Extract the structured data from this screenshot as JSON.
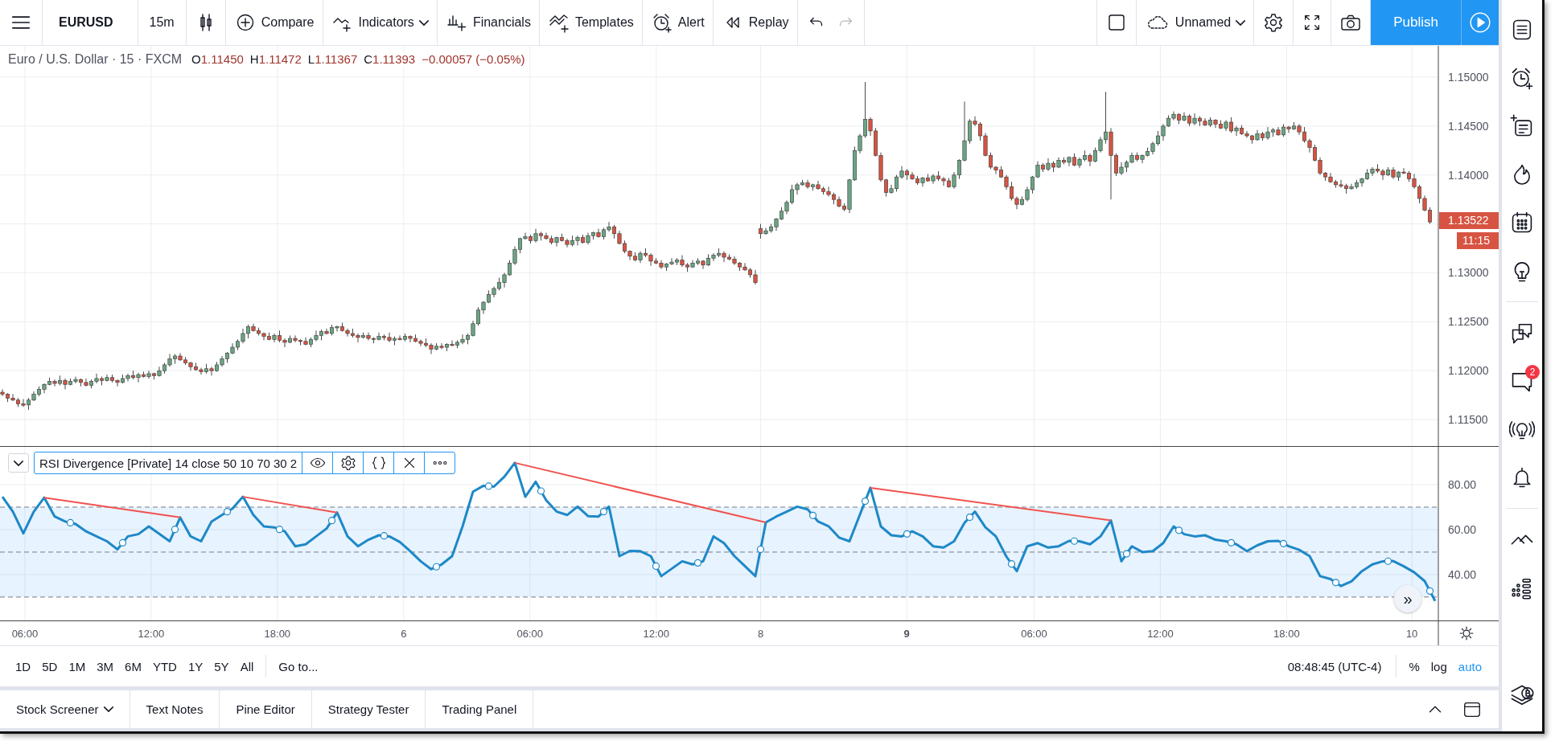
{
  "toolbar": {
    "symbol": "EURUSD",
    "interval": "15m",
    "buttons": [
      {
        "label": "Compare",
        "dropdown": false
      },
      {
        "label": "Indicators",
        "dropdown": true
      },
      {
        "label": "Financials",
        "dropdown": false
      },
      {
        "label": "Templates",
        "dropdown": false
      },
      {
        "label": "Alert",
        "dropdown": false
      },
      {
        "label": "Replay",
        "dropdown": false
      }
    ],
    "undo": {
      "disabled": false
    },
    "redo": {
      "disabled": true
    },
    "layout": {
      "label": "Unnamed",
      "dropdown": true
    },
    "publish": "Publish"
  },
  "legend": {
    "title": "Euro / U.S. Dollar · 15 · FXCM",
    "ohlc": [
      {
        "label": "O",
        "value": "1.11450"
      },
      {
        "label": "H",
        "value": "1.11472"
      },
      {
        "label": "L",
        "value": "1.11367"
      },
      {
        "label": "C",
        "value": "1.11393"
      }
    ],
    "change": "−0.00057 (−0.05%)"
  },
  "price_pane": {
    "last_price": "1.13522",
    "countdown": "11:15",
    "chart_data": {
      "type": "candlestick",
      "ylim": [
        1.1123,
        1.1532
      ],
      "grid": true,
      "yticks": [
        {
          "value": 1.15,
          "label": "1.15000"
        },
        {
          "value": 1.145,
          "label": "1.14500"
        },
        {
          "value": 1.14,
          "label": "1.14000"
        },
        {
          "value": 1.13,
          "label": "1.13000"
        },
        {
          "value": 1.125,
          "label": "1.12500"
        },
        {
          "value": 1.12,
          "label": "1.12000"
        },
        {
          "value": 1.115,
          "label": "1.11500"
        }
      ],
      "categories": [
        null,
        null,
        null,
        null,
        null,
        null,
        null,
        null,
        null,
        null,
        null,
        null,
        null,
        null,
        null,
        null,
        null,
        null,
        null,
        null,
        null,
        null,
        null,
        null,
        null,
        null,
        null,
        null,
        null,
        null,
        null,
        null,
        null,
        null,
        null,
        null,
        null,
        null,
        null,
        null,
        null,
        null,
        null,
        null,
        null,
        null,
        null,
        null,
        null,
        null,
        null,
        null,
        null,
        null,
        null,
        null,
        null,
        null,
        null,
        null,
        null,
        null,
        null,
        null,
        null,
        null,
        null,
        null,
        null,
        null,
        null,
        null,
        null,
        null,
        null,
        null,
        null,
        null,
        null,
        null,
        null,
        null,
        null,
        null,
        null,
        null,
        null,
        null,
        null,
        null,
        null,
        null,
        null,
        null,
        null,
        null,
        null,
        null,
        null,
        null,
        null,
        null,
        null,
        null,
        null,
        null,
        null,
        null,
        null,
        null,
        null,
        null,
        null,
        null,
        null,
        null,
        null,
        null,
        null,
        null,
        null,
        null,
        null,
        null,
        null,
        null,
        null,
        null,
        null,
        null,
        null,
        null,
        null,
        null,
        null,
        null,
        null,
        null,
        null,
        null,
        null,
        null,
        null,
        null,
        null,
        null,
        null,
        null,
        null,
        null,
        null,
        null,
        null,
        null,
        null,
        null,
        null,
        null,
        null,
        null,
        null,
        null,
        null,
        null,
        null,
        null,
        null,
        null,
        null,
        null,
        null,
        null,
        null,
        null,
        null,
        null,
        null,
        null,
        null,
        null,
        null,
        null,
        null,
        null,
        null,
        null,
        null,
        null,
        null,
        null,
        null,
        null,
        null,
        null,
        null,
        null,
        null,
        null,
        null,
        null,
        null,
        null,
        null,
        null,
        null,
        null,
        null,
        null,
        null,
        null,
        null,
        null,
        null,
        null,
        null,
        null,
        null,
        null,
        null,
        null,
        null,
        null,
        null,
        null,
        null,
        null,
        null,
        null,
        null,
        null,
        null,
        null,
        null,
        null,
        null,
        null,
        null,
        null,
        null,
        null,
        null,
        null,
        null,
        null,
        null,
        null,
        null,
        null,
        null,
        null,
        null,
        null,
        null,
        null,
        null,
        null,
        null,
        null,
        null,
        null,
        null,
        null,
        null,
        null,
        null,
        null,
        null,
        null,
        null,
        null,
        null,
        null,
        null,
        null
      ],
      "ohlc": [
        [
          1.1178,
          1.1181,
          1.1174,
          1.1176
        ],
        [
          1.1176,
          1.1177,
          1.1168,
          1.1172
        ],
        [
          1.1172,
          1.1176,
          1.1169,
          1.117
        ],
        [
          1.117,
          1.1172,
          1.1163,
          1.1166
        ],
        [
          1.1166,
          1.1171,
          1.1163,
          1.1165
        ],
        [
          1.1165,
          1.1172,
          1.116,
          1.117
        ],
        [
          1.117,
          1.1179,
          1.1169,
          1.1176
        ],
        [
          1.1176,
          1.1184,
          1.1174,
          1.1181
        ],
        [
          1.1181,
          1.1187,
          1.1177,
          1.1186
        ],
        [
          1.1186,
          1.1193,
          1.1185,
          1.1189
        ],
        [
          1.1189,
          1.1191,
          1.1184,
          1.1187
        ],
        [
          1.1187,
          1.1195,
          1.1185,
          1.119
        ],
        [
          1.119,
          1.1192,
          1.1181,
          1.1186
        ],
        [
          1.1186,
          1.1192,
          1.1185,
          1.1189
        ],
        [
          1.1189,
          1.1194,
          1.1187,
          1.1191
        ],
        [
          1.1191,
          1.1192,
          1.1184,
          1.1188
        ],
        [
          1.1188,
          1.1192,
          1.1184,
          1.1185
        ],
        [
          1.1185,
          1.1191,
          1.1182,
          1.1189
        ],
        [
          1.1189,
          1.1197,
          1.1187,
          1.1192
        ],
        [
          1.1192,
          1.1194,
          1.1185,
          1.119
        ],
        [
          1.119,
          1.1196,
          1.1189,
          1.1193
        ],
        [
          1.1193,
          1.1196,
          1.1188,
          1.119
        ],
        [
          1.119,
          1.1191,
          1.1184,
          1.1188
        ],
        [
          1.1188,
          1.1196,
          1.1187,
          1.1192
        ],
        [
          1.1192,
          1.1197,
          1.1189,
          1.1195
        ],
        [
          1.1195,
          1.12,
          1.1191,
          1.1193
        ],
        [
          1.1193,
          1.1198,
          1.1188,
          1.1196
        ],
        [
          1.1196,
          1.1199,
          1.1193,
          1.1194
        ],
        [
          1.1194,
          1.12,
          1.1192,
          1.1197
        ],
        [
          1.1197,
          1.1198,
          1.1191,
          1.1195
        ],
        [
          1.1195,
          1.1204,
          1.1194,
          1.12
        ],
        [
          1.12,
          1.1208,
          1.1197,
          1.1206
        ],
        [
          1.1206,
          1.1217,
          1.1204,
          1.1212
        ],
        [
          1.1212,
          1.1217,
          1.1207,
          1.1215
        ],
        [
          1.1215,
          1.1218,
          1.121,
          1.1211
        ],
        [
          1.1211,
          1.1214,
          1.1206,
          1.1208
        ],
        [
          1.1208,
          1.1209,
          1.12,
          1.1204
        ],
        [
          1.1204,
          1.1208,
          1.12,
          1.1201
        ],
        [
          1.1201,
          1.1203,
          1.1196,
          1.1199
        ],
        [
          1.1199,
          1.1207,
          1.1197,
          1.1202
        ],
        [
          1.1202,
          1.1204,
          1.1195,
          1.12
        ],
        [
          1.12,
          1.1209,
          1.1199,
          1.1206
        ],
        [
          1.1206,
          1.1215,
          1.1204,
          1.1212
        ],
        [
          1.1212,
          1.1219,
          1.1208,
          1.1218
        ],
        [
          1.1218,
          1.1228,
          1.1217,
          1.1224
        ],
        [
          1.1224,
          1.1232,
          1.1221,
          1.123
        ],
        [
          1.123,
          1.1243,
          1.1228,
          1.1238
        ],
        [
          1.1238,
          1.1247,
          1.1233,
          1.1245
        ],
        [
          1.1245,
          1.1248,
          1.124,
          1.1241
        ],
        [
          1.1241,
          1.1244,
          1.1236,
          1.1238
        ],
        [
          1.1238,
          1.1239,
          1.1231,
          1.1235
        ],
        [
          1.1235,
          1.1239,
          1.1231,
          1.1232
        ],
        [
          1.1232,
          1.1238,
          1.1229,
          1.1236
        ],
        [
          1.1236,
          1.1241,
          1.1229,
          1.1231
        ],
        [
          1.1231,
          1.1233,
          1.1224,
          1.1229
        ],
        [
          1.1229,
          1.1236,
          1.1228,
          1.1233
        ],
        [
          1.1233,
          1.1236,
          1.1229,
          1.1231
        ],
        [
          1.1231,
          1.1232,
          1.1226,
          1.123
        ],
        [
          1.123,
          1.1234,
          1.1226,
          1.1227
        ],
        [
          1.1227,
          1.1234,
          1.1224,
          1.1232
        ],
        [
          1.1232,
          1.1241,
          1.123,
          1.1236
        ],
        [
          1.1236,
          1.1242,
          1.1231,
          1.124
        ],
        [
          1.124,
          1.1243,
          1.1237,
          1.1238
        ],
        [
          1.1238,
          1.1247,
          1.1236,
          1.1244
        ],
        [
          1.1244,
          1.1246,
          1.124,
          1.1245
        ],
        [
          1.1245,
          1.1249,
          1.124,
          1.1241
        ],
        [
          1.1241,
          1.1243,
          1.1235,
          1.1238
        ],
        [
          1.1238,
          1.1243,
          1.1234,
          1.1236
        ],
        [
          1.1236,
          1.1238,
          1.1229,
          1.1234
        ],
        [
          1.1234,
          1.1239,
          1.1233,
          1.1236
        ],
        [
          1.1236,
          1.1239,
          1.1231,
          1.1233
        ],
        [
          1.1233,
          1.1234,
          1.1228,
          1.1232
        ],
        [
          1.1232,
          1.1239,
          1.1231,
          1.1235
        ],
        [
          1.1235,
          1.1237,
          1.1231,
          1.1234
        ],
        [
          1.1234,
          1.1239,
          1.1229,
          1.1231
        ],
        [
          1.1231,
          1.1235,
          1.1226,
          1.1233
        ],
        [
          1.1233,
          1.1236,
          1.1231,
          1.1232
        ],
        [
          1.1232,
          1.1238,
          1.123,
          1.1235
        ],
        [
          1.1235,
          1.1236,
          1.1229,
          1.1233
        ],
        [
          1.1233,
          1.1237,
          1.1229,
          1.123
        ],
        [
          1.123,
          1.1232,
          1.1225,
          1.1228
        ],
        [
          1.1228,
          1.1233,
          1.1224,
          1.1226
        ],
        [
          1.1226,
          1.1228,
          1.1217,
          1.1222
        ],
        [
          1.1222,
          1.1228,
          1.1221,
          1.1225
        ],
        [
          1.1225,
          1.1228,
          1.1222,
          1.1224
        ],
        [
          1.1224,
          1.1228,
          1.122,
          1.1227
        ],
        [
          1.1227,
          1.1231,
          1.1225,
          1.1226
        ],
        [
          1.1226,
          1.1231,
          1.1223,
          1.1229
        ],
        [
          1.1229,
          1.1237,
          1.1227,
          1.1232
        ],
        [
          1.1232,
          1.1238,
          1.1227,
          1.1236
        ],
        [
          1.1236,
          1.1251,
          1.1235,
          1.1248
        ],
        [
          1.1248,
          1.1265,
          1.1246,
          1.1262
        ],
        [
          1.1262,
          1.1271,
          1.1258,
          1.127
        ],
        [
          1.127,
          1.1282,
          1.1269,
          1.1278
        ],
        [
          1.1278,
          1.1286,
          1.1275,
          1.1284
        ],
        [
          1.1284,
          1.1295,
          1.1282,
          1.129
        ],
        [
          1.129,
          1.13,
          1.1285,
          1.1298
        ],
        [
          1.1298,
          1.1313,
          1.1297,
          1.131
        ],
        [
          1.131,
          1.1327,
          1.1308,
          1.1324
        ],
        [
          1.1324,
          1.1336,
          1.132,
          1.1335
        ],
        [
          1.1335,
          1.1341,
          1.1334,
          1.1337
        ],
        [
          1.1337,
          1.1339,
          1.133,
          1.1333
        ],
        [
          1.1333,
          1.1345,
          1.1331,
          1.134
        ],
        [
          1.134,
          1.1342,
          1.1333,
          1.1338
        ],
        [
          1.1338,
          1.1341,
          1.1334,
          1.1335
        ],
        [
          1.1335,
          1.1338,
          1.1329,
          1.1331
        ],
        [
          1.1331,
          1.1337,
          1.1327,
          1.1336
        ],
        [
          1.1336,
          1.134,
          1.1332,
          1.1333
        ],
        [
          1.1333,
          1.1335,
          1.1326,
          1.1329
        ],
        [
          1.1329,
          1.1338,
          1.1327,
          1.1333
        ],
        [
          1.1333,
          1.1338,
          1.1328,
          1.1336
        ],
        [
          1.1336,
          1.1339,
          1.133,
          1.1331
        ],
        [
          1.1331,
          1.1341,
          1.1329,
          1.1338
        ],
        [
          1.1338,
          1.1342,
          1.1334,
          1.1341
        ],
        [
          1.1341,
          1.1345,
          1.1336,
          1.1337
        ],
        [
          1.1337,
          1.1346,
          1.1334,
          1.1344
        ],
        [
          1.1344,
          1.1352,
          1.1342,
          1.1347
        ],
        [
          1.1347,
          1.1349,
          1.1335,
          1.134
        ],
        [
          1.134,
          1.1343,
          1.1329,
          1.133
        ],
        [
          1.133,
          1.1333,
          1.132,
          1.1322
        ],
        [
          1.1322,
          1.1323,
          1.1313,
          1.1317
        ],
        [
          1.1317,
          1.1321,
          1.1312,
          1.1313
        ],
        [
          1.1313,
          1.1322,
          1.131,
          1.132
        ],
        [
          1.132,
          1.1325,
          1.1316,
          1.1318
        ],
        [
          1.1318,
          1.132,
          1.1307,
          1.1312
        ],
        [
          1.1312,
          1.1315,
          1.1309,
          1.131
        ],
        [
          1.131,
          1.1313,
          1.1304,
          1.1306
        ],
        [
          1.1306,
          1.131,
          1.1302,
          1.1309
        ],
        [
          1.1309,
          1.1315,
          1.1308,
          1.1311
        ],
        [
          1.1311,
          1.1315,
          1.1308,
          1.1313
        ],
        [
          1.1313,
          1.1318,
          1.1306,
          1.1308
        ],
        [
          1.1308,
          1.131,
          1.1301,
          1.1306
        ],
        [
          1.1306,
          1.1313,
          1.1305,
          1.131
        ],
        [
          1.131,
          1.1315,
          1.1308,
          1.1312
        ],
        [
          1.1312,
          1.1313,
          1.1304,
          1.1308
        ],
        [
          1.1308,
          1.1319,
          1.1307,
          1.1315
        ],
        [
          1.1315,
          1.132,
          1.1312,
          1.1318
        ],
        [
          1.1318,
          1.1325,
          1.1316,
          1.132
        ],
        [
          1.132,
          1.1322,
          1.1311,
          1.1316
        ],
        [
          1.1316,
          1.1319,
          1.1313,
          1.1314
        ],
        [
          1.1314,
          1.1317,
          1.1308,
          1.131
        ],
        [
          1.131,
          1.1311,
          1.1302,
          1.1306
        ],
        [
          1.1306,
          1.131,
          1.1302,
          1.1303
        ],
        [
          1.1303,
          1.1305,
          1.1295,
          1.1298
        ],
        [
          1.1298,
          1.1303,
          1.1288,
          1.129
        ],
        [
          1.1345,
          1.135,
          1.1335,
          1.134
        ],
        [
          1.134,
          1.1346,
          1.1339,
          1.1343
        ],
        [
          1.1343,
          1.135,
          1.1341,
          1.1347
        ],
        [
          1.1347,
          1.1356,
          1.1343,
          1.1355
        ],
        [
          1.1355,
          1.1367,
          1.1354,
          1.1363
        ],
        [
          1.1363,
          1.1374,
          1.136,
          1.1372
        ],
        [
          1.1372,
          1.139,
          1.137,
          1.1385
        ],
        [
          1.1385,
          1.1392,
          1.138,
          1.139
        ],
        [
          1.139,
          1.1395,
          1.1389,
          1.1392
        ],
        [
          1.1392,
          1.1395,
          1.1386,
          1.1388
        ],
        [
          1.1388,
          1.1391,
          1.1384,
          1.139
        ],
        [
          1.139,
          1.1394,
          1.1385,
          1.1386
        ],
        [
          1.1386,
          1.1388,
          1.138,
          1.1383
        ],
        [
          1.1383,
          1.1388,
          1.1378,
          1.138
        ],
        [
          1.138,
          1.1382,
          1.137,
          1.1375
        ],
        [
          1.1375,
          1.1378,
          1.1367,
          1.1368
        ],
        [
          1.1368,
          1.1371,
          1.1363,
          1.1365
        ],
        [
          1.1365,
          1.1396,
          1.1361,
          1.1395
        ],
        [
          1.1395,
          1.1429,
          1.1394,
          1.1425
        ],
        [
          1.1425,
          1.1442,
          1.1422,
          1.144
        ],
        [
          1.144,
          1.1495,
          1.1438,
          1.1457
        ],
        [
          1.1457,
          1.1459,
          1.144,
          1.1445
        ],
        [
          1.1445,
          1.1448,
          1.1419,
          1.142
        ],
        [
          1.142,
          1.1423,
          1.1393,
          1.1395
        ],
        [
          1.1395,
          1.1396,
          1.1378,
          1.1382
        ],
        [
          1.1382,
          1.139,
          1.1381,
          1.1386
        ],
        [
          1.1386,
          1.14,
          1.1383,
          1.1398
        ],
        [
          1.1398,
          1.1409,
          1.1396,
          1.1404
        ],
        [
          1.1404,
          1.1406,
          1.1395,
          1.14
        ],
        [
          1.14,
          1.1403,
          1.1395,
          1.1396
        ],
        [
          1.1396,
          1.1399,
          1.139,
          1.1392
        ],
        [
          1.1392,
          1.1398,
          1.1388,
          1.1397
        ],
        [
          1.1397,
          1.1401,
          1.1393,
          1.1394
        ],
        [
          1.1394,
          1.1401,
          1.1391,
          1.1399
        ],
        [
          1.1399,
          1.1404,
          1.1394,
          1.1396
        ],
        [
          1.1396,
          1.1398,
          1.1389,
          1.1394
        ],
        [
          1.1394,
          1.1397,
          1.1387,
          1.1388
        ],
        [
          1.1388,
          1.1403,
          1.1386,
          1.14
        ],
        [
          1.14,
          1.1416,
          1.1396,
          1.1415
        ],
        [
          1.1415,
          1.1475,
          1.1414,
          1.1435
        ],
        [
          1.1435,
          1.1457,
          1.1432,
          1.1455
        ],
        [
          1.1455,
          1.146,
          1.145,
          1.1452
        ],
        [
          1.1452,
          1.1454,
          1.1435,
          1.144
        ],
        [
          1.144,
          1.1443,
          1.1419,
          1.142
        ],
        [
          1.142,
          1.1423,
          1.1406,
          1.1408
        ],
        [
          1.1408,
          1.1409,
          1.1401,
          1.1405
        ],
        [
          1.1405,
          1.1409,
          1.1397,
          1.1398
        ],
        [
          1.1398,
          1.14,
          1.1385,
          1.1388
        ],
        [
          1.1388,
          1.1393,
          1.1374,
          1.1376
        ],
        [
          1.1376,
          1.1378,
          1.1365,
          1.137
        ],
        [
          1.137,
          1.1378,
          1.1369,
          1.1375
        ],
        [
          1.1375,
          1.1388,
          1.1373,
          1.1385
        ],
        [
          1.1385,
          1.1399,
          1.1381,
          1.1398
        ],
        [
          1.1398,
          1.1414,
          1.1397,
          1.141
        ],
        [
          1.141,
          1.1412,
          1.1403,
          1.1406
        ],
        [
          1.1406,
          1.1417,
          1.1404,
          1.1412
        ],
        [
          1.1412,
          1.1414,
          1.1403,
          1.1408
        ],
        [
          1.1408,
          1.1418,
          1.1407,
          1.1415
        ],
        [
          1.1415,
          1.1418,
          1.1411,
          1.1413
        ],
        [
          1.1413,
          1.1419,
          1.1409,
          1.1418
        ],
        [
          1.1418,
          1.1422,
          1.1409,
          1.141
        ],
        [
          1.141,
          1.1418,
          1.1407,
          1.1416
        ],
        [
          1.1416,
          1.1425,
          1.1414,
          1.142
        ],
        [
          1.142,
          1.1422,
          1.1409,
          1.1414
        ],
        [
          1.1414,
          1.1428,
          1.1413,
          1.1425
        ],
        [
          1.1425,
          1.1439,
          1.1423,
          1.1436
        ],
        [
          1.1436,
          1.1485,
          1.1432,
          1.1444
        ],
        [
          1.1444,
          1.1448,
          1.1375,
          1.142
        ],
        [
          1.142,
          1.1422,
          1.1399,
          1.1402
        ],
        [
          1.1402,
          1.1413,
          1.14,
          1.1408
        ],
        [
          1.1408,
          1.1415,
          1.1403,
          1.1413
        ],
        [
          1.1413,
          1.1423,
          1.1412,
          1.142
        ],
        [
          1.142,
          1.1423,
          1.1414,
          1.1416
        ],
        [
          1.1416,
          1.1421,
          1.1412,
          1.142
        ],
        [
          1.142,
          1.1428,
          1.1419,
          1.1424
        ],
        [
          1.1424,
          1.1434,
          1.1421,
          1.1432
        ],
        [
          1.1432,
          1.1445,
          1.143,
          1.144
        ],
        [
          1.144,
          1.1452,
          1.1435,
          1.145
        ],
        [
          1.145,
          1.1461,
          1.1449,
          1.1458
        ],
        [
          1.1458,
          1.1465,
          1.1456,
          1.1462
        ],
        [
          1.1462,
          1.1463,
          1.1452,
          1.1456
        ],
        [
          1.1456,
          1.1464,
          1.1455,
          1.146
        ],
        [
          1.146,
          1.1462,
          1.145,
          1.1453
        ],
        [
          1.1453,
          1.1463,
          1.1451,
          1.1458
        ],
        [
          1.1458,
          1.146,
          1.145,
          1.1455
        ],
        [
          1.1455,
          1.1458,
          1.145,
          1.1451
        ],
        [
          1.1451,
          1.1459,
          1.1449,
          1.1456
        ],
        [
          1.1456,
          1.1457,
          1.1448,
          1.1452
        ],
        [
          1.1452,
          1.1456,
          1.1447,
          1.1448
        ],
        [
          1.1448,
          1.1456,
          1.1445,
          1.1454
        ],
        [
          1.1454,
          1.1459,
          1.1443,
          1.1445
        ],
        [
          1.1445,
          1.145,
          1.144,
          1.1448
        ],
        [
          1.1448,
          1.1451,
          1.1441,
          1.1442
        ],
        [
          1.1442,
          1.1445,
          1.1438,
          1.144
        ],
        [
          1.144,
          1.1441,
          1.1432,
          1.1436
        ],
        [
          1.1436,
          1.1446,
          1.1435,
          1.1442
        ],
        [
          1.1442,
          1.1444,
          1.1435,
          1.1438
        ],
        [
          1.1438,
          1.1449,
          1.1436,
          1.1444
        ],
        [
          1.1444,
          1.1448,
          1.1439,
          1.1446
        ],
        [
          1.1446,
          1.1449,
          1.144,
          1.1441
        ],
        [
          1.1441,
          1.1452,
          1.1439,
          1.1449
        ],
        [
          1.1449,
          1.145,
          1.1443,
          1.1447
        ],
        [
          1.1447,
          1.1454,
          1.1446,
          1.145
        ],
        [
          1.145,
          1.1452,
          1.1441,
          1.1444
        ],
        [
          1.1444,
          1.1449,
          1.1433,
          1.1435
        ],
        [
          1.1435,
          1.1437,
          1.1423,
          1.1428
        ],
        [
          1.1428,
          1.1431,
          1.1414,
          1.1415
        ],
        [
          1.1415,
          1.1418,
          1.14,
          1.1402
        ],
        [
          1.1402,
          1.1403,
          1.1394,
          1.1398
        ],
        [
          1.1398,
          1.1402,
          1.1392,
          1.1393
        ],
        [
          1.1393,
          1.1395,
          1.1387,
          1.139
        ],
        [
          1.139,
          1.1395,
          1.1387,
          1.1389
        ],
        [
          1.1389,
          1.1391,
          1.1381,
          1.1386
        ],
        [
          1.1386,
          1.1391,
          1.1385,
          1.1388
        ],
        [
          1.1388,
          1.1395,
          1.1386,
          1.1392
        ],
        [
          1.1392,
          1.1397,
          1.1388,
          1.1396
        ],
        [
          1.1396,
          1.1406,
          1.1395,
          1.1402
        ],
        [
          1.1402,
          1.1408,
          1.1399,
          1.1406
        ],
        [
          1.1406,
          1.1411,
          1.1402,
          1.1404
        ],
        [
          1.1404,
          1.1406,
          1.1395,
          1.14
        ],
        [
          1.14,
          1.1408,
          1.1399,
          1.1405
        ],
        [
          1.1405,
          1.1408,
          1.1396,
          1.1398
        ],
        [
          1.1398,
          1.1404,
          1.1394,
          1.1403
        ],
        [
          1.1403,
          1.1407,
          1.1401,
          1.1402
        ],
        [
          1.1402,
          1.1404,
          1.1393,
          1.1396
        ],
        [
          1.1396,
          1.1401,
          1.1386,
          1.1388
        ],
        [
          1.1388,
          1.139,
          1.1371,
          1.1376
        ],
        [
          1.1376,
          1.1379,
          1.1363,
          1.1364
        ],
        [
          1.1364,
          1.1367,
          1.135,
          1.1352
        ]
      ]
    }
  },
  "indicator": {
    "label": "RSI Divergence [Private] 14 close 50 10 70 30 2",
    "chart_data": {
      "type": "line",
      "categories": [
        null,
        null,
        null,
        null,
        null,
        null,
        null,
        null,
        null,
        null,
        null,
        null,
        null,
        null,
        null,
        null,
        null,
        null,
        null,
        null,
        null,
        null,
        null,
        null,
        null,
        null,
        null,
        null,
        null,
        null,
        null,
        null,
        null,
        null,
        null,
        null,
        null,
        null,
        null,
        null,
        null,
        null,
        null,
        null,
        null,
        null,
        null,
        null,
        null,
        null,
        null,
        null,
        null,
        null,
        null,
        null,
        null,
        null,
        null,
        null,
        null,
        null,
        null,
        null,
        null,
        null,
        null,
        null,
        null,
        null,
        null,
        null,
        null,
        null,
        null,
        null,
        null,
        null,
        null,
        null,
        null,
        null,
        null,
        null,
        null,
        null,
        null,
        null,
        null,
        null,
        null,
        null,
        null,
        null,
        null,
        null,
        null,
        null,
        null,
        null,
        null,
        null,
        null,
        null,
        null,
        null,
        null,
        null,
        null,
        null,
        null,
        null,
        null,
        null,
        null,
        null,
        null,
        null,
        null,
        null,
        null,
        null,
        null,
        null,
        null,
        null,
        null,
        null,
        null,
        null,
        null,
        null,
        null,
        null,
        null,
        null,
        null,
        null
      ],
      "series": [
        {
          "color": "#1e88c7",
          "values": [
            74.6,
            68.0,
            58.3,
            68.0,
            74.2,
            65.8,
            63.6,
            62.5,
            59.2,
            57.0,
            54.8,
            51.2,
            57.0,
            58.0,
            61.4,
            58.1,
            54.8,
            65.4,
            57.0,
            54.8,
            63.6,
            66.5,
            69.4,
            74.6,
            66.5,
            61.4,
            61.0,
            59.2,
            52.6,
            53.5,
            57.0,
            60.5,
            67.6,
            57.0,
            52.6,
            55.5,
            57.5,
            57.0,
            54.5,
            50.4,
            45.9,
            42.4,
            44.5,
            48.2,
            61.4,
            76.9,
            79.5,
            79.1,
            83.5,
            89.7,
            74.6,
            81.3,
            73.0,
            68.0,
            66.5,
            70.2,
            66.0,
            65.8,
            70.2,
            48.2,
            50.5,
            50.4,
            48.2,
            39.3,
            42.6,
            45.9,
            44.5,
            45.9,
            57.0,
            54.0,
            48.2,
            43.8,
            39.3,
            63.2,
            65.8,
            68.0,
            70.2,
            69.0,
            63.6,
            61.5,
            56.5,
            54.8,
            66.7,
            78.6,
            61.4,
            57.5,
            57.0,
            59.2,
            57.0,
            52.6,
            52.0,
            54.8,
            63.0,
            68.0,
            61.0,
            57.0,
            48.0,
            41.5,
            52.6,
            54.0,
            52.0,
            52.6,
            55.0,
            54.8,
            53.5,
            57.0,
            64.1,
            45.9,
            52.6,
            50.0,
            50.4,
            54.0,
            61.4,
            58.0,
            57.0,
            57.5,
            55.5,
            54.8,
            53.5,
            50.4,
            53.0,
            54.8,
            55.0,
            52.6,
            51.0,
            48.2,
            39.3,
            38.0,
            34.9,
            37.0,
            41.5,
            44.5,
            45.9,
            46.0,
            43.7,
            41.0,
            37.1,
            28.3
          ]
        }
      ],
      "ylim": [
        19.6,
        96.8
      ],
      "grid": true,
      "yticks": [
        {
          "value": 80,
          "label": "80.00"
        },
        {
          "value": 60,
          "label": "60.00"
        },
        {
          "value": 40,
          "label": "40.00"
        }
      ]
    }
  },
  "scroll_button": "»",
  "time_axis": {
    "ticks": [
      {
        "label": "06:00",
        "bold": false
      },
      {
        "label": "12:00",
        "bold": false
      },
      {
        "label": "18:00",
        "bold": false
      },
      {
        "label": "6",
        "bold": false
      },
      {
        "label": "06:00",
        "bold": false
      },
      {
        "label": "12:00",
        "bold": false
      },
      {
        "label": "8",
        "bold": false
      },
      {
        "label": "9",
        "bold": true
      },
      {
        "label": "06:00",
        "bold": false
      },
      {
        "label": "12:00",
        "bold": false
      },
      {
        "label": "18:00",
        "bold": false
      },
      {
        "label": "10",
        "bold": false
      }
    ]
  },
  "range_bar": {
    "ranges": [
      "1D",
      "5D",
      "1M",
      "3M",
      "6M",
      "YTD",
      "1Y",
      "5Y",
      "All"
    ],
    "goto": "Go to...",
    "clock": "08:48:45 (UTC-4)",
    "scale_options": [
      {
        "label": "%",
        "selected": false
      },
      {
        "label": "log",
        "selected": false
      },
      {
        "label": "auto",
        "selected": true
      }
    ]
  },
  "bottom_tabs": [
    {
      "label": "Stock Screener",
      "dropdown": true
    },
    {
      "label": "Text Notes",
      "dropdown": false
    },
    {
      "label": "Pine Editor",
      "dropdown": false
    },
    {
      "label": "Strategy Tester",
      "dropdown": false
    },
    {
      "label": "Trading Panel",
      "dropdown": false
    }
  ],
  "sidebar": {
    "badge": "2"
  }
}
